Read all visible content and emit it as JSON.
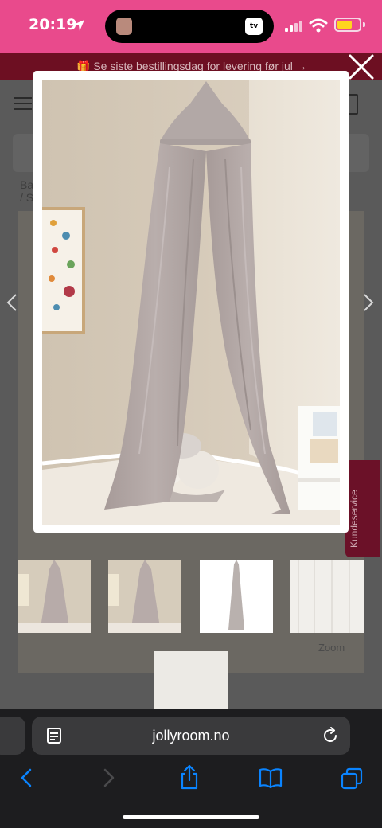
{
  "status_bar": {
    "time": "20:19",
    "tv_label": "tv",
    "colors": {
      "background": "#e94a8c",
      "battery": "#ffd51e"
    },
    "icons": [
      "location-arrow-icon",
      "signal-icon",
      "wifi-icon",
      "battery-icon"
    ]
  },
  "banner": {
    "text": "🎁 Se siste bestillingsdag for levering før jul →",
    "color": "#6d0f22"
  },
  "overlay": {
    "close_icon": "close-icon"
  },
  "page": {
    "breadcrumb_line1": "Ba",
    "breadcrumb_line2": "/  S",
    "zoom_label": "Zoom",
    "side_tab_label": "Kundeservice"
  },
  "browser": {
    "url": "jollyroom.no",
    "icons": [
      "reader-icon",
      "reload-icon",
      "back-icon",
      "forward-icon",
      "share-icon",
      "bookmarks-icon",
      "tabs-icon"
    ],
    "accent_color": "#0a84ff"
  }
}
